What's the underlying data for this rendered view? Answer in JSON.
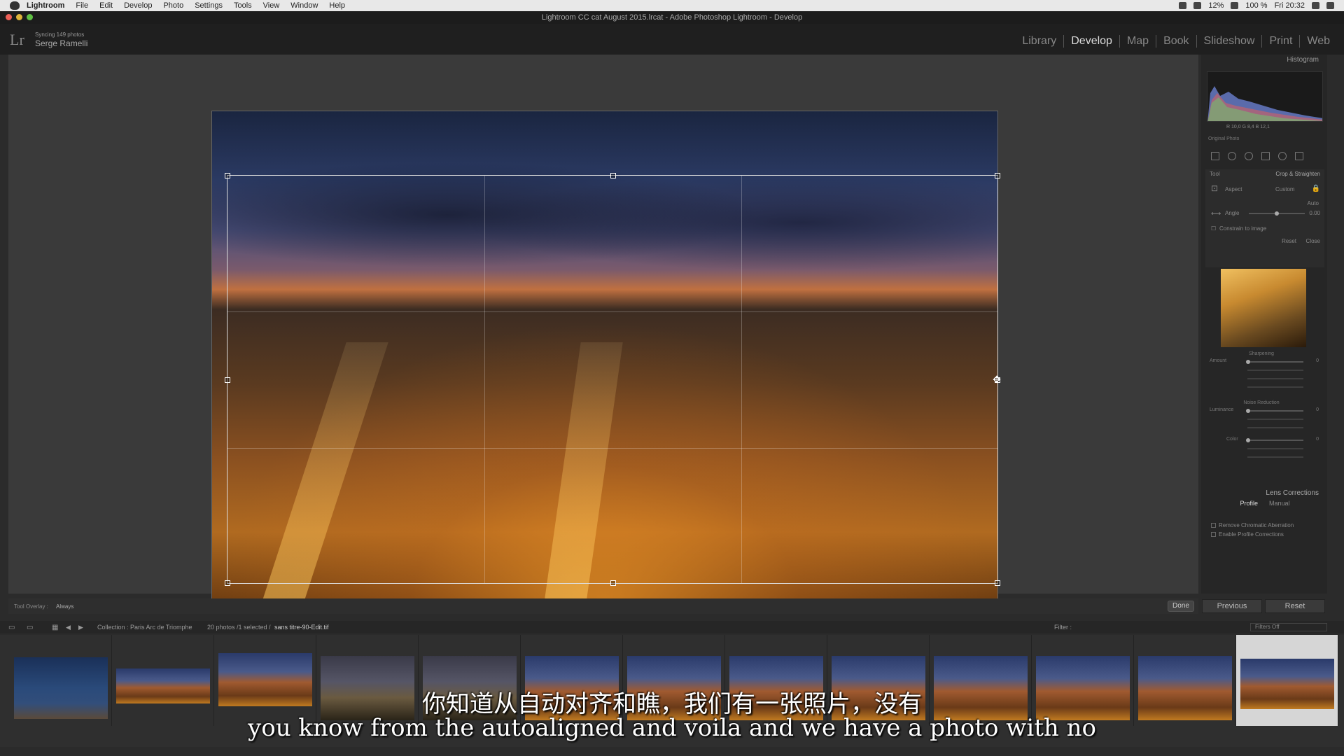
{
  "menubar": {
    "app": "Lightroom",
    "items": [
      "File",
      "Edit",
      "Develop",
      "Photo",
      "Settings",
      "Tools",
      "View",
      "Window",
      "Help"
    ],
    "battery": "12%",
    "battery2": "100 %",
    "clock": "Fri 20:32"
  },
  "window": {
    "title": "Lightroom CC cat August 2015.lrcat - Adobe Photoshop Lightroom - Develop"
  },
  "identity": {
    "logo": "Lr",
    "sync_status": "Syncing 149 photos",
    "user": "Serge Ramelli"
  },
  "modules": [
    {
      "label": "Library"
    },
    {
      "label": "Develop"
    },
    {
      "label": "Map"
    },
    {
      "label": "Book"
    },
    {
      "label": "Slideshow"
    },
    {
      "label": "Print"
    },
    {
      "label": "Web"
    }
  ],
  "active_module": "Develop",
  "toolbar": {
    "overlay_label": "Tool Overlay :",
    "overlay_value": "Always",
    "done_label": "Done"
  },
  "right_panel": {
    "histogram_title": "Histogram",
    "histogram_values": "R  10,0   G  8,4   B  12,1",
    "original_photo": "Original Photo",
    "tool_label": "Tool",
    "crop_title": "Crop & Straighten",
    "aspect_label": "Aspect",
    "aspect_value": "Custom",
    "auto_label": "Auto",
    "angle_label": "Angle",
    "angle_value": "0.00",
    "constrain_label": "Constrain to image",
    "reset_label": "Reset",
    "close_label": "Close",
    "sharpening_title": "Sharpening",
    "amount_label": "Amount",
    "amount_value": "0",
    "noise_title": "Noise Reduction",
    "luminance_label": "Luminance",
    "luminance_value": "0",
    "color_label": "Color",
    "color_value": "0",
    "lens_title": "Lens Corrections",
    "lens_tabs": [
      "Profile",
      "Manual"
    ],
    "lens_options": [
      "Remove Chromatic Aberration",
      "Enable Profile Corrections"
    ],
    "previous_label": "Previous",
    "reset_button_label": "Reset"
  },
  "filmbar": {
    "collection": "Collection : Paris Arc de Triomphe",
    "count": "20 photos /1 selected /",
    "filename": "sans titre-90-Edit.tif",
    "filter_label": "Filter :",
    "filter_value": "Filters Off"
  },
  "subtitles": {
    "chinese": "你知道从自动对齐和瞧，我们有一张照片，没有",
    "english": "you know from the autoaligned and voila and we have a photo with no"
  },
  "colors": {
    "panel": "#262626",
    "workarea": "#3a3a3a",
    "menubar": "#e8e8e8"
  }
}
